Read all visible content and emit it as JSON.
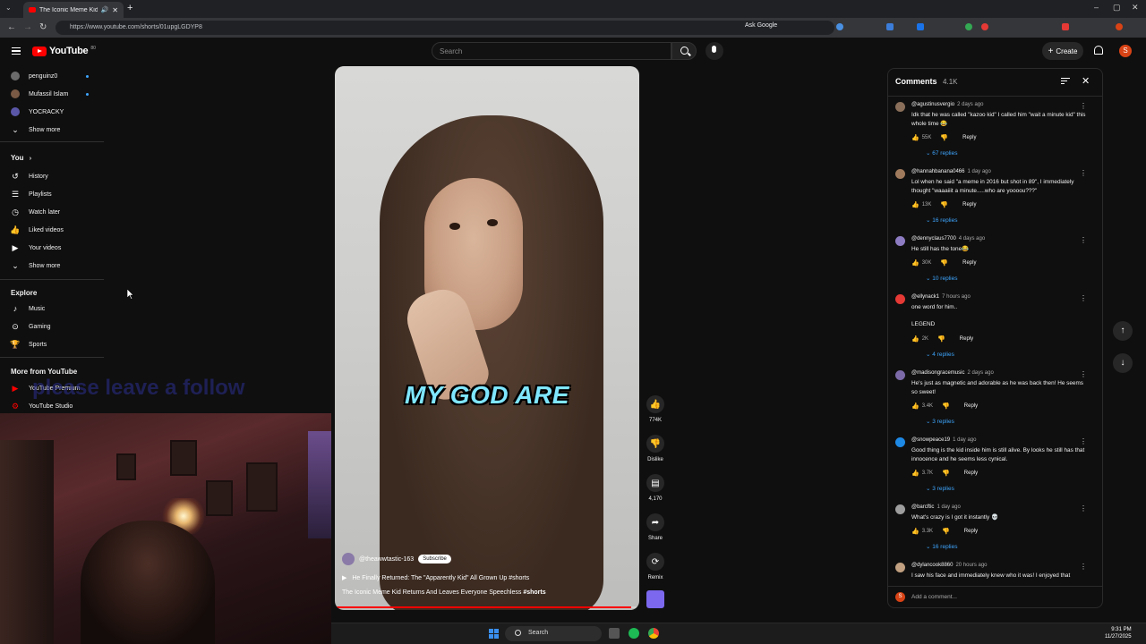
{
  "browser": {
    "tab_title": "The Iconic Meme Kid Retu",
    "new_tab_symbol": "+",
    "url": "https://www.youtube.com/shorts/01upgLGDYP8",
    "ask_google": "Ask Google"
  },
  "header": {
    "logo_text": "YouTube",
    "logo_badge": "80",
    "search_placeholder": "Search",
    "create_label": "Create",
    "avatar_letter": "S"
  },
  "sidebar": {
    "subscriptions": [
      {
        "label": "penguinz0",
        "color": "#6b6b6b",
        "dot": true
      },
      {
        "label": "Mufassil Islam",
        "color": "#7a5a45",
        "dot": true
      },
      {
        "label": "YOCRACKY",
        "color": "#5b57a8",
        "dot": false
      }
    ],
    "show_more_1": "Show more",
    "you_heading": "You",
    "you_items": [
      {
        "label": "History",
        "icon": "history-icon"
      },
      {
        "label": "Playlists",
        "icon": "playlists-icon"
      },
      {
        "label": "Watch later",
        "icon": "watch-later-icon"
      },
      {
        "label": "Liked videos",
        "icon": "liked-videos-icon"
      },
      {
        "label": "Your videos",
        "icon": "your-videos-icon"
      }
    ],
    "show_more_2": "Show more",
    "explore_heading": "Explore",
    "explore_items": [
      {
        "label": "Music",
        "icon": "music-icon"
      },
      {
        "label": "Gaming",
        "icon": "gaming-icon"
      },
      {
        "label": "Sports",
        "icon": "sports-icon"
      }
    ],
    "more_heading": "More from YouTube",
    "more_items": [
      {
        "label": "YouTube Premium",
        "icon": "youtube-premium-icon"
      },
      {
        "label": "YouTube Studio",
        "icon": "youtube-studio-icon"
      }
    ]
  },
  "stream_overlay_text": "please leave a follow",
  "video": {
    "caption": "MY GOD ARE",
    "channel": "@theawwtastic-163",
    "subscribe_label": "Subscribe",
    "title": "He Finally Returned: The \"Apparently Kid\" All Grown Up #shorts",
    "description": "The Iconic Meme Kid Returns And Leaves Everyone Speechless",
    "description_tag": "#shorts",
    "progress": 0.98
  },
  "actions": {
    "likes": "774K",
    "dislike_label": "Dislike",
    "comments": "4,170",
    "share_label": "Share",
    "remix_label": "Remix"
  },
  "comments_panel": {
    "title": "Comments",
    "count": "4.1K",
    "add_placeholder": "Add a comment...",
    "items": [
      {
        "user": "@agustinusvergio",
        "ago": "2 days ago",
        "text": "Idk that he was called \"kazoo kid\" I called him \"wait a minute kid\" this whole time 😂",
        "likes": "55K",
        "replies": "67 replies",
        "color": "#8a6f5a"
      },
      {
        "user": "@hannahbanana0466",
        "ago": "1 day ago",
        "text": "Lol when he said \"a meme in 2016 but shot in 89\", I immediately thought \"waaaiiit a minute.....who are yoooou???\"",
        "likes": "13K",
        "replies": "16 replies",
        "color": "#a07a5c"
      },
      {
        "user": "@dennyclaus7700",
        "ago": "4 days ago",
        "text": "He still has the tone😂",
        "likes": "30K",
        "replies": "10 replies",
        "color": "#8e7cc3"
      },
      {
        "user": "@ellynack1",
        "ago": "7 hours ago",
        "text": "one word for him..\n\nLEGEND",
        "likes": "2K",
        "replies": "4 replies",
        "color": "#e53935"
      },
      {
        "user": "@madisongracemusic",
        "ago": "2 days ago",
        "text": "He's just as magnetic and adorable as he was back then! He seems so sweet!",
        "likes": "3.4K",
        "replies": "3 replies",
        "color": "#7c6aa8"
      },
      {
        "user": "@snowpeace19",
        "ago": "1 day ago",
        "text": "Good thing is the kid inside him is still alive. By looks he still has that innocence and he seems less cynical.",
        "likes": "3.7K",
        "replies": "3 replies",
        "color": "#1e88e5"
      },
      {
        "user": "@barcftic",
        "ago": "1 day ago",
        "text": "What's crazy is I got it instantly 💀",
        "likes": "3.3K",
        "replies": "16 replies",
        "color": "#9e9e9e"
      },
      {
        "user": "@dylancook8860",
        "ago": "20 hours ago",
        "text": "I saw his face and immediately knew who it was! I enjoyed that",
        "likes": "",
        "replies": "",
        "color": "#c0a080"
      }
    ],
    "reply_label": "Reply"
  },
  "taskbar": {
    "search_label": "Search",
    "time": "9:31 PM",
    "date": "11/27/2025"
  }
}
